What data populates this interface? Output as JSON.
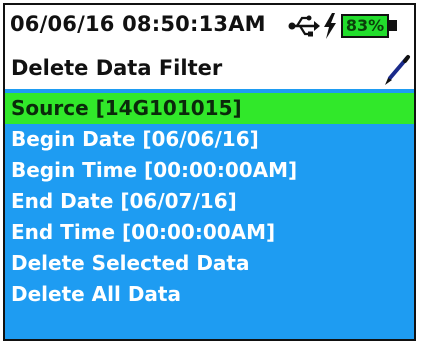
{
  "status_bar": {
    "datetime": "06/06/16  08:50:13AM",
    "usb_icon": "usb-icon",
    "charging_icon": "lightning-bolt-icon",
    "battery_percent": "83%",
    "battery_color": "#22dd2c"
  },
  "header": {
    "title": "Delete Data Filter",
    "pen_icon": "pen-icon"
  },
  "menu": {
    "background_color": "#1e9cf2",
    "selected_color": "#31e82a",
    "items": [
      {
        "label": "Source [14G101015]",
        "selected": true
      },
      {
        "label": "Begin Date [06/06/16]",
        "selected": false
      },
      {
        "label": "Begin Time [00:00:00AM]",
        "selected": false
      },
      {
        "label": "End Date [06/07/16]",
        "selected": false
      },
      {
        "label": "End Time [00:00:00AM]",
        "selected": false
      },
      {
        "label": "Delete Selected Data",
        "selected": false
      },
      {
        "label": "Delete All Data",
        "selected": false
      }
    ]
  }
}
